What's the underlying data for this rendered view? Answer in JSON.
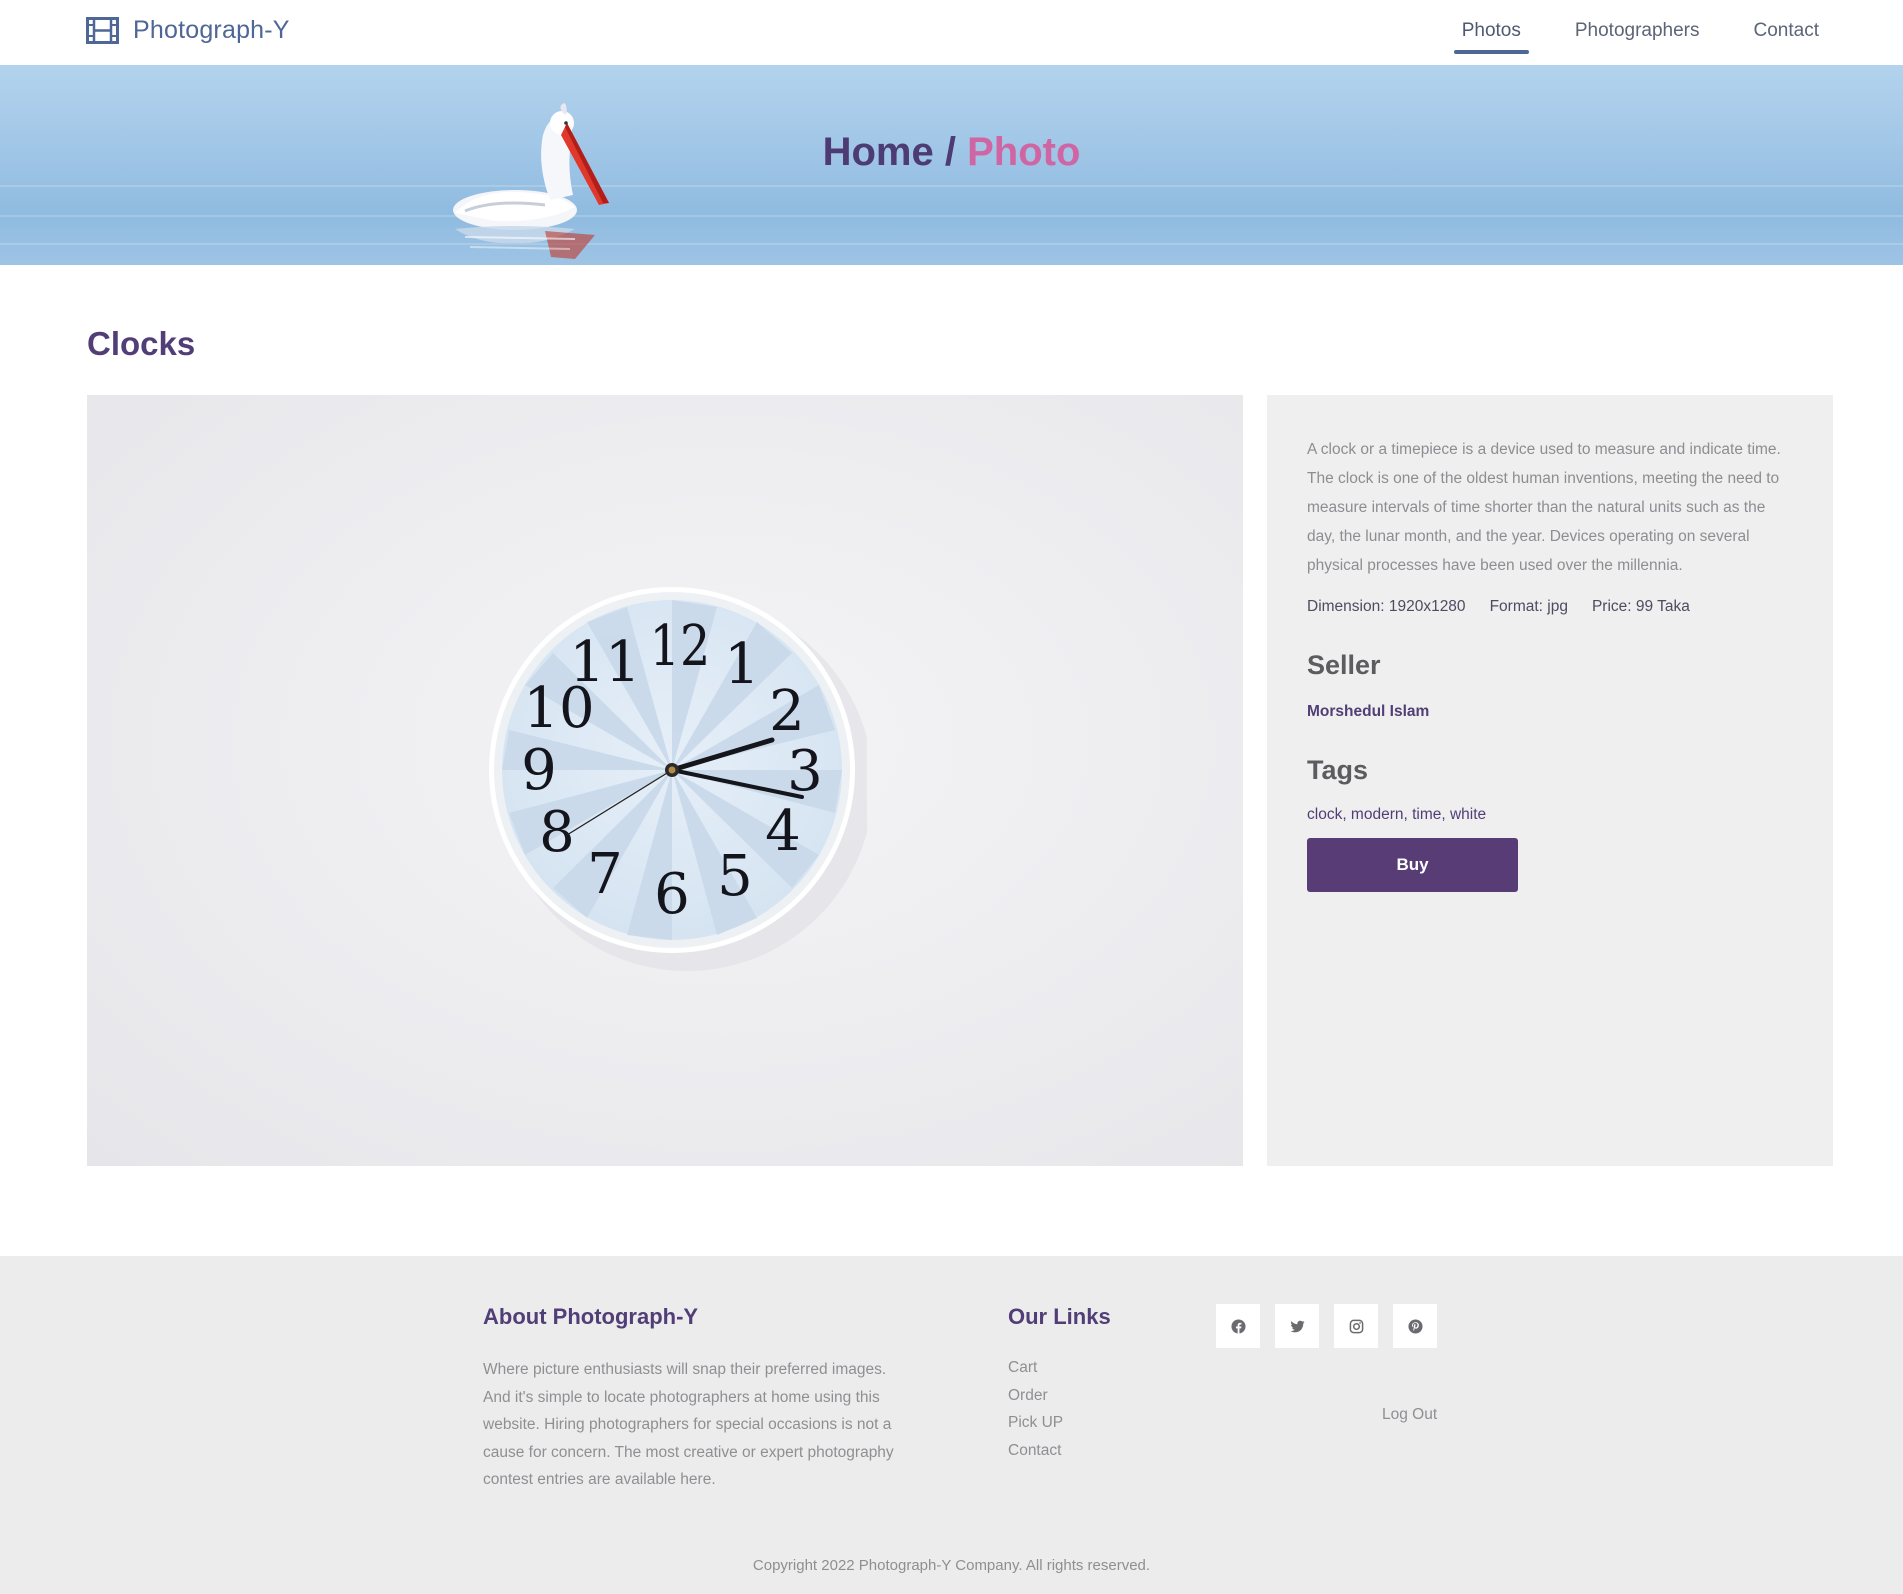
{
  "navbar": {
    "brand": "Photograph-Y",
    "brand_icon": "film-icon",
    "links": [
      {
        "label": "Photos",
        "active": true
      },
      {
        "label": "Photographers",
        "active": false
      },
      {
        "label": "Contact",
        "active": false
      }
    ]
  },
  "hero": {
    "crumb_home": "Home",
    "crumb_separator": "/",
    "crumb_current": "Photo",
    "image": "pelican-on-water"
  },
  "photo": {
    "title": "Clocks",
    "image": "wall-clock-photo",
    "description": "A clock or a timepiece is a device used to measure and indicate time. The clock is one of the oldest human inventions, meeting the need to measure intervals of time shorter than the natural units such as the day, the lunar month, and the year. Devices operating on several physical processes have been used over the millennia.",
    "dimension": "Dimension: 1920x1280",
    "format": "Format: jpg",
    "price": "Price: 99 Taka",
    "seller_heading": "Seller",
    "seller_name": "Morshedul Islam",
    "tags_heading": "Tags",
    "tags": "clock, modern, time, white",
    "buy_label": "Buy"
  },
  "footer": {
    "about_heading": "About Photograph-Y",
    "about_text": "Where picture enthusiasts will snap their preferred images. And it's simple to locate photographers at home using this website. Hiring photographers for special occasions is not a cause for concern. The most creative or expert photography contest entries are available here.",
    "links_heading": "Our Links",
    "links": [
      "Cart",
      "Order",
      "Pick UP",
      "Contact"
    ],
    "socials": [
      "facebook-icon",
      "twitter-icon",
      "instagram-icon",
      "pinterest-icon"
    ],
    "logout": "Log Out",
    "copyright": "Copyright 2022 Photograph-Y Company. All rights reserved."
  },
  "colors": {
    "brand": "#4f6796",
    "primary_purple": "#573c76",
    "accent_pink": "#d065a4",
    "panel_gray": "#efefef"
  }
}
